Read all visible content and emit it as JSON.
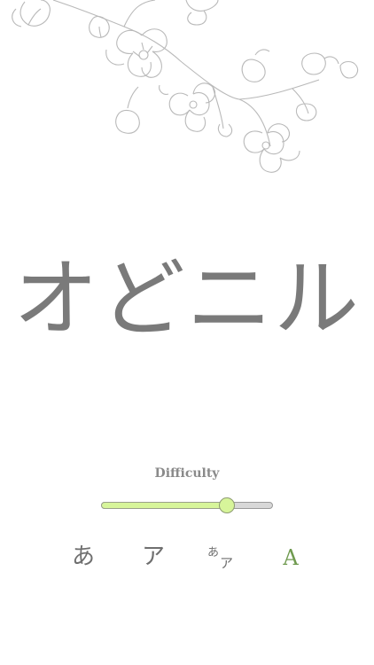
{
  "word": {
    "text": "オどニル",
    "color": "#7a7a7a"
  },
  "difficulty": {
    "label": "Difficulty",
    "value": 0.73,
    "fill_color": "#d7f59a",
    "track_color": "#d8d8d8"
  },
  "modes": {
    "hiragana": "あ",
    "katakana": "ア",
    "mixed_hira": "あ",
    "mixed_kata": "ア",
    "romaji": "A",
    "selected": "romaji",
    "selected_color": "#6f9a4f"
  },
  "decoration": {
    "icon": "cherry-blossom-branch"
  }
}
